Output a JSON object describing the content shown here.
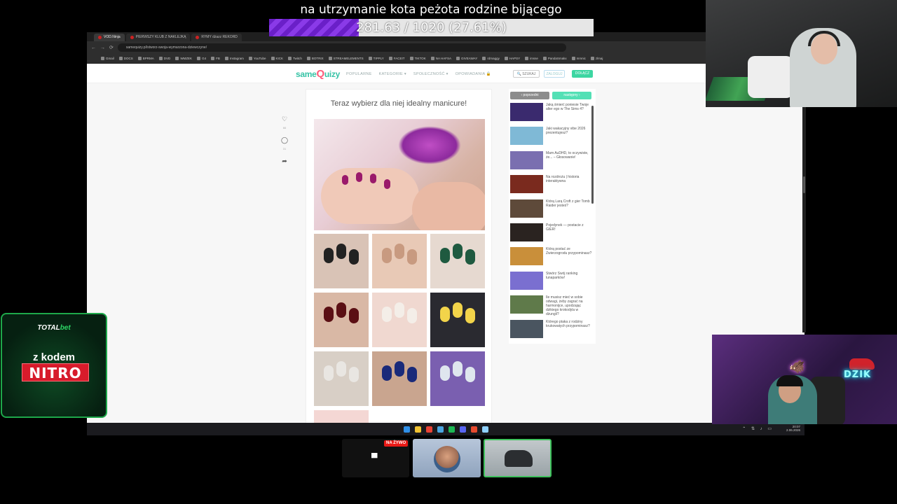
{
  "overlay": {
    "goal_title": "na utrzymanie kota peżota rodzine bijącego",
    "goal_progress_text": "281.63 / 1020 (27.61%)",
    "goal_progress_fraction": 0.2761
  },
  "browser": {
    "tabs": [
      "VOD.Ninja",
      "PIERWSZY KLUB Z NAKLEJKĄ",
      "RYMY dżazz REKORD"
    ],
    "url": "samequizy.pl/stworz-swoja-wymarzona-dziewczyne/",
    "bookmarks": [
      "Gmail",
      "DOCS",
      "BPRMA",
      "DVD",
      "WMZEK",
      "G4",
      "FB",
      "Instagram",
      "YouTube",
      "KICK",
      "Twitch",
      "BOTRIX",
      "STREAMELEMENTS",
      "TIPPLY",
      "FACEIT",
      "TIKTOK",
      "NA HAFSA",
      "GIVEAWAY",
      "rdmaggy",
      "HAPSY",
      "imsse",
      "PandaSmakx",
      "mmnic",
      "zlmaj"
    ]
  },
  "site": {
    "logo_same": "same",
    "logo_q": "Q",
    "logo_uizy": "uizy",
    "nav": [
      "POPULARNE",
      "KATEGORIE ▾",
      "SPOŁECZNOŚĆ ▾",
      "OPOWIADANIA 🔒"
    ],
    "search_label": "🔍 SZUKAJ",
    "login_label": "ZALOGUJ",
    "signup_label": "DOŁĄCZ",
    "share_counts": [
      "66",
      "31"
    ],
    "question": "Teraz wybierz dla niej idealny manicure!",
    "sidebar_prev": "‹ poprzedni",
    "sidebar_next": "następny ›",
    "sidebar_items": [
      "Jaką śmierć poniesie Twoje alter ego w The Sims 4?",
      "Jaki wakacyjny vibe 2026 prezentujesz?",
      "Mam AuDHD, to oczywiste, że... – Głosowanie!",
      "Na rozdrożu | historia interaktywna",
      "Którą Larą Croft z gier Tomb Raider jesteś?",
      "Pojedynek — postacie z GIER!",
      "Którą postać ze Zwierzogrodu przypominasz?",
      "Stwórz Swój ranking lunaparków!",
      "Ile musisz mieć w sobie odwagi, żeby zagrać na harmonijce, upodzając dzikiego krokodyla w dżungli?",
      "Którego ptaka z rodziny krukowatych przypominasz?"
    ],
    "sidebar_thumb_colors": [
      "#3a2a6e",
      "#7fb9d6",
      "#7a6fb0",
      "#7a2a1e",
      "#5e4a3a",
      "#2a2320",
      "#c98f3a",
      "#7a6fd0",
      "#5f7a4a",
      "#4a5560"
    ],
    "nail_tiles": [
      {
        "bg": "#d9c3b6",
        "nail": "#222222"
      },
      {
        "bg": "#e8c9b6",
        "nail": "#c89a80"
      },
      {
        "bg": "#e6d9d0",
        "nail": "#1f5a40"
      },
      {
        "bg": "#d9b8a5",
        "nail": "#5b0f14"
      },
      {
        "bg": "#f0d8d0",
        "nail": "#f4eee8"
      },
      {
        "bg": "#2a2a30",
        "nail": "#f2d44a"
      },
      {
        "bg": "#d8cfc6",
        "nail": "#e9e6e2"
      },
      {
        "bg": "#c9a58f",
        "nail": "#1a2a7a"
      },
      {
        "bg": "#7a5fb0",
        "nail": "#dfe6ee"
      }
    ]
  },
  "taskbar": {
    "clock_time": "20:07",
    "clock_date": "2.06.2026"
  },
  "sponsor": {
    "brand_a": "TOTAL",
    "brand_b": "bet",
    "line1": "z kodem",
    "code": "NITRO"
  },
  "cam": {
    "brand": "DZIK"
  },
  "call": {
    "live_badge": "NA ŻYWO"
  },
  "colors": {
    "accent_green": "#3dd6a2",
    "goal_purple": "#6a1fc8",
    "live_red": "#e91916"
  }
}
